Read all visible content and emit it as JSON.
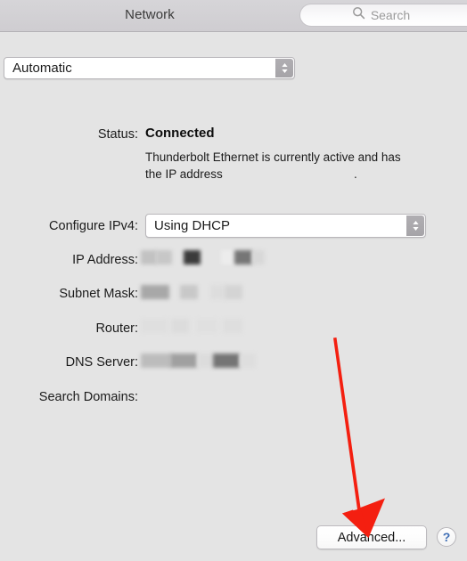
{
  "window": {
    "title": "Network"
  },
  "search": {
    "placeholder": "Search",
    "icon": "search-icon"
  },
  "location_popup": {
    "value": "Automatic",
    "icon": "updown-chevron-icon"
  },
  "status": {
    "label": "Status:",
    "value": "Connected",
    "description": "Thunderbolt Ethernet is currently active and has the IP address",
    "description_suffix": ".",
    "ip_redacted": true
  },
  "fields": {
    "ipv4": {
      "label": "Configure IPv4:",
      "value": "Using DHCP",
      "icon": "updown-chevron-icon"
    },
    "ip_address": {
      "label": "IP Address:",
      "value": "",
      "redacted": true
    },
    "subnet_mask": {
      "label": "Subnet Mask:",
      "value": "",
      "redacted": true
    },
    "router": {
      "label": "Router:",
      "value": "",
      "redacted": true
    },
    "dns_server": {
      "label": "DNS Server:",
      "value": "",
      "redacted": true
    },
    "search_domains": {
      "label": "Search Domains:",
      "value": "",
      "redacted": false
    }
  },
  "buttons": {
    "advanced": "Advanced...",
    "help": "?"
  },
  "annotation": {
    "type": "arrow",
    "color": "#f41f10",
    "points_to": "advanced-button"
  },
  "colors": {
    "toolbar_top": "#d6d5d8",
    "toolbar_bottom": "#cfcdd1",
    "content_background": "#e4e4e4",
    "annotation_red": "#f41f10",
    "help_blue": "#3f6fb5"
  }
}
